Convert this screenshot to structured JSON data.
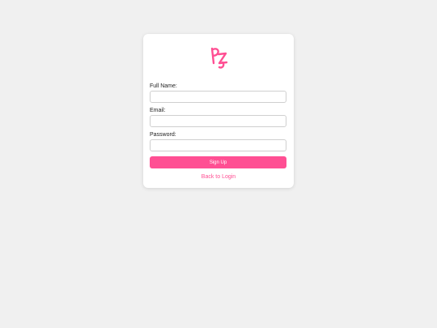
{
  "logo": {
    "icon": "pz-logo",
    "color": "#ff4f93"
  },
  "form": {
    "full_name_label": "Full Name:",
    "full_name_value": "",
    "email_label": "Email:",
    "email_value": "",
    "password_label": "Password:",
    "password_value": "",
    "submit_label": "Sign Up",
    "back_link_label": "Back to Login"
  },
  "colors": {
    "accent": "#ff4f93",
    "background": "#f0f0f0",
    "card": "#ffffff"
  }
}
